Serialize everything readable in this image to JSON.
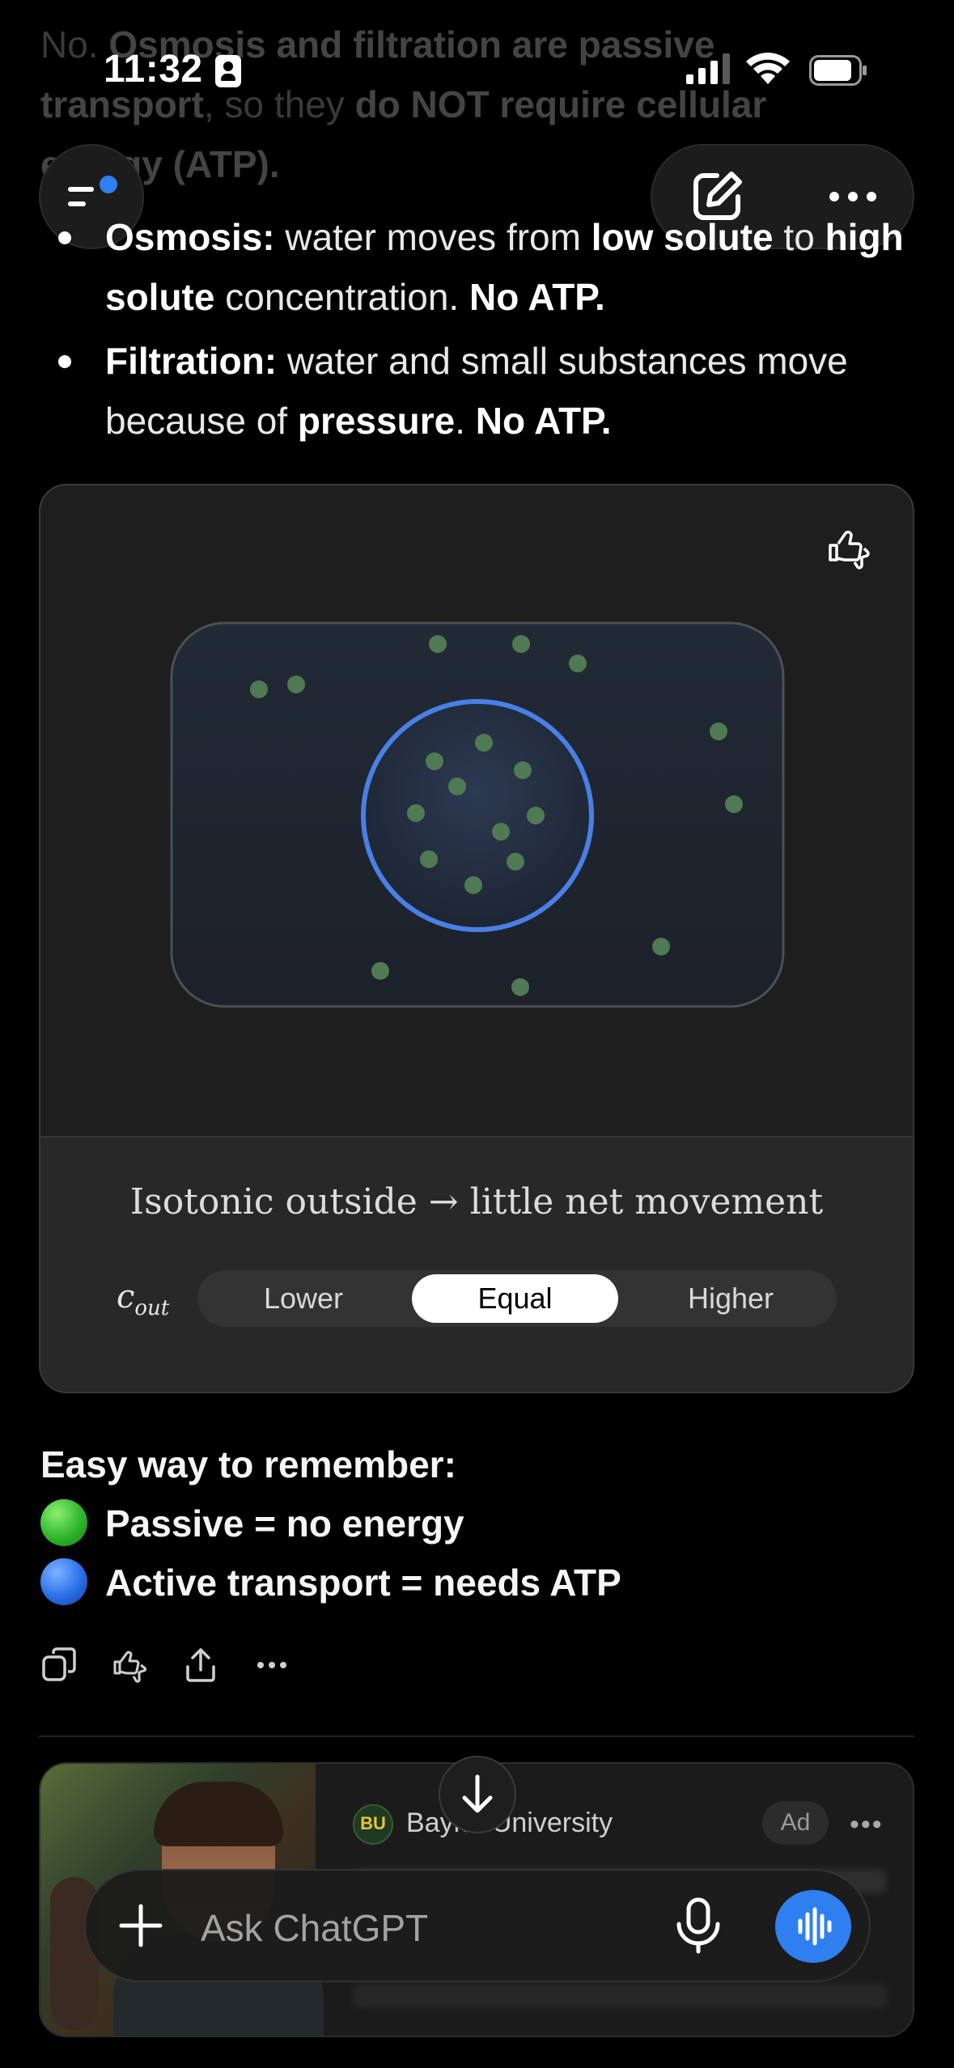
{
  "status_bar": {
    "time": "11:32"
  },
  "top_faded": {
    "p1": "No. ",
    "p1_bold": "Osmosis and filtration are passive transport",
    "p2": ", so they ",
    "p2_bold": "do NOT require cellular energy (ATP)."
  },
  "bullets": [
    {
      "term": "Osmosis:",
      "text1": " water moves from ",
      "bold1": "low solute",
      "text2": " to ",
      "bold2": "high solute",
      "text3": " concentration. ",
      "tail": "No ATP."
    },
    {
      "term": "Filtration:",
      "text1": " water and small substances move because of ",
      "bold1": "pressure",
      "text2": ". ",
      "tail": "No ATP."
    }
  ],
  "widget": {
    "caption": "Isotonic outside → little net movement",
    "control_label": "c",
    "control_sub": "out",
    "options": [
      "Lower",
      "Equal",
      "Higher"
    ],
    "selected": "Equal",
    "colors": {
      "membrane": "#4a7fe6",
      "particles": "#4f7a53"
    }
  },
  "remember": {
    "heading": "Easy way to remember:",
    "line1": "Passive = no energy",
    "line2": "Active transport = needs ATP"
  },
  "actions": [
    "copy-icon",
    "thumbs-up-down-icon",
    "share-icon",
    "more-icon"
  ],
  "ad": {
    "brand": "Baylor University",
    "badge": "Ad"
  },
  "composer": {
    "placeholder": "Ask ChatGPT"
  }
}
